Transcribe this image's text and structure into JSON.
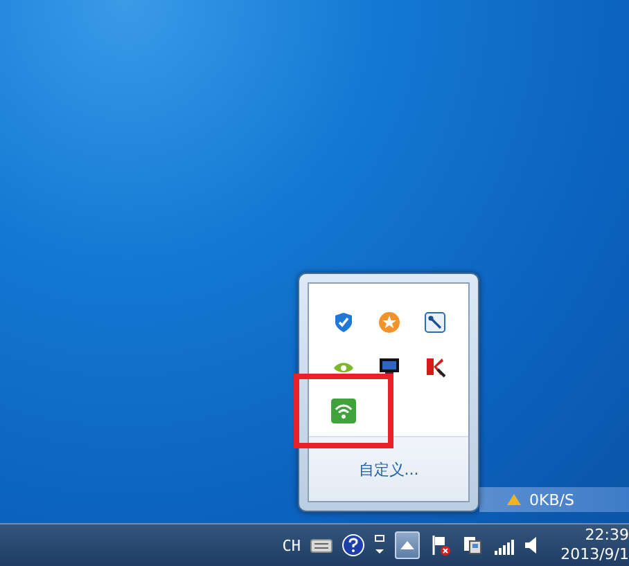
{
  "tray_popup": {
    "icons": [
      {
        "kind": "shield"
      },
      {
        "kind": "star"
      },
      {
        "kind": "wrench"
      },
      {
        "kind": "eye"
      },
      {
        "kind": "monitor"
      },
      {
        "kind": "k-arrow"
      },
      {
        "kind": "wifi"
      }
    ],
    "customize_link": "自定义..."
  },
  "speed_widget": {
    "reading": "0KB/S"
  },
  "taskbar": {
    "language": "CH",
    "tray_icons": [
      {
        "kind": "keyboard"
      },
      {
        "kind": "help"
      },
      {
        "kind": "windows"
      },
      {
        "kind": "overflow",
        "pressed": true
      },
      {
        "kind": "flag"
      },
      {
        "kind": "network"
      },
      {
        "kind": "signal"
      },
      {
        "kind": "speaker"
      }
    ],
    "clock": {
      "time": "22:39",
      "date": "2013/9/1"
    }
  }
}
